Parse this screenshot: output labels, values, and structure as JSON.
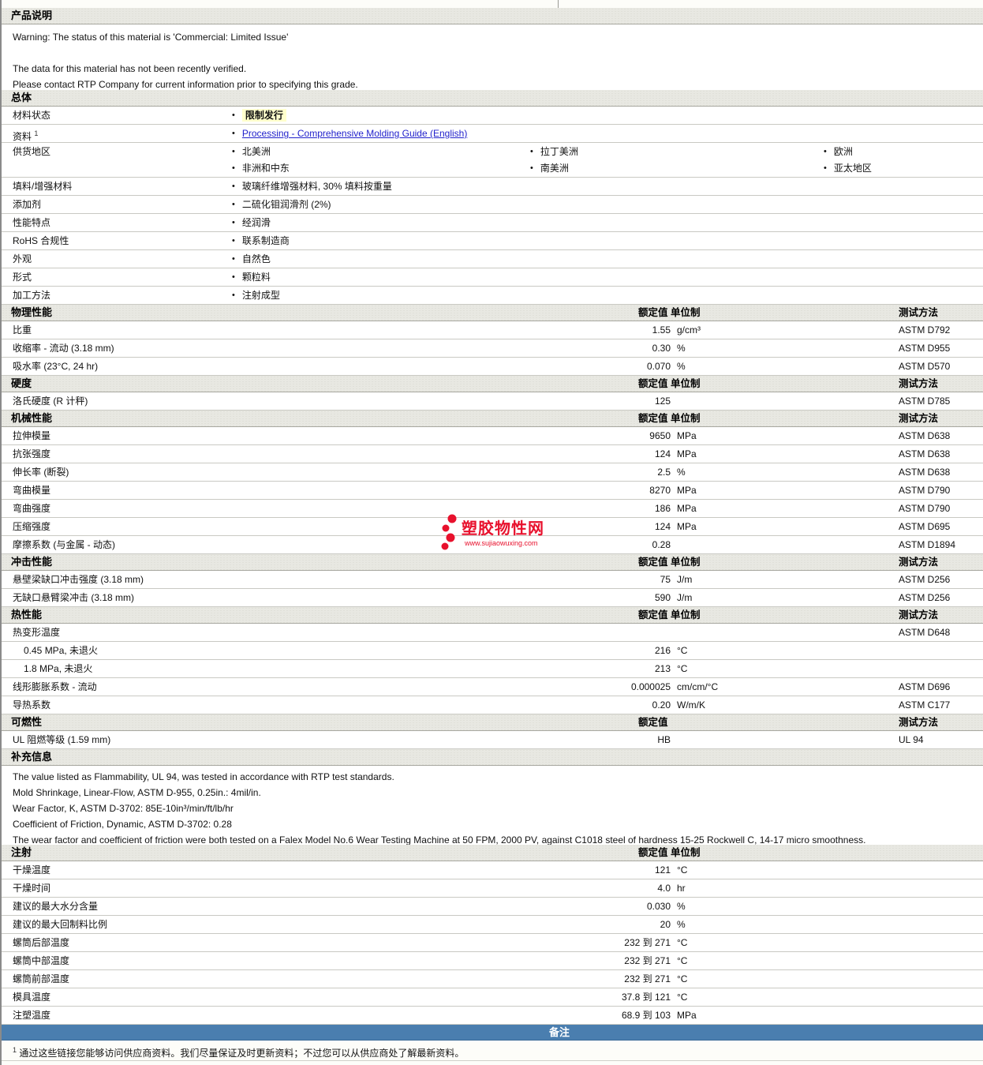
{
  "header": {
    "product_desc_title": "产品说明"
  },
  "description": {
    "line1": "Warning: The status of this material is 'Commercial: Limited Issue'",
    "line2": "The data for this material has not been recently verified.",
    "line3": "Please contact RTP Company for current information prior to specifying this grade."
  },
  "general": {
    "title": "总体",
    "rows": [
      {
        "label": "材料状态",
        "text": "限制发行"
      },
      {
        "label": "资料",
        "sup": "1",
        "text": "Processing - Comprehensive Molding Guide (English)"
      },
      {
        "label": "供货地区",
        "cols": [
          [
            "北美洲",
            "非洲和中东"
          ],
          [
            "拉丁美洲",
            "南美洲"
          ],
          [
            "欧洲",
            "亚太地区"
          ]
        ]
      },
      {
        "label": "填料/增强材料",
        "text": "玻璃纤维增强材料, 30% 填料按重量"
      },
      {
        "label": "添加剂",
        "text": "二硫化钼润滑剂 (2%)"
      },
      {
        "label": "性能特点",
        "text": "经润滑"
      },
      {
        "label": "RoHS 合规性",
        "text": "联系制造商"
      },
      {
        "label": "外观",
        "text": "自然色"
      },
      {
        "label": "形式",
        "text": "颗粒料"
      },
      {
        "label": "加工方法",
        "text": "注射成型"
      }
    ]
  },
  "col_headers": {
    "value_unit": "额定值 单位制",
    "value_only": "额定值",
    "method": "测试方法"
  },
  "physical": {
    "title": "物理性能",
    "rows": [
      {
        "label": "比重",
        "value": "1.55",
        "unit": "g/cm³",
        "method": "ASTM D792"
      },
      {
        "label": "收缩率 - 流动 (3.18 mm)",
        "value": "0.30",
        "unit": "%",
        "method": "ASTM D955"
      },
      {
        "label": "吸水率 (23°C, 24 hr)",
        "value": "0.070",
        "unit": "%",
        "method": "ASTM D570"
      }
    ]
  },
  "hardness": {
    "title": "硬度",
    "rows": [
      {
        "label": "洛氏硬度 (R 计秤)",
        "value": "125",
        "unit": "",
        "method": "ASTM D785"
      }
    ]
  },
  "mechanical": {
    "title": "机械性能",
    "rows": [
      {
        "label": "拉伸模量",
        "value": "9650",
        "unit": "MPa",
        "method": "ASTM D638"
      },
      {
        "label": "抗张强度",
        "value": "124",
        "unit": "MPa",
        "method": "ASTM D638"
      },
      {
        "label": "伸长率 (断裂)",
        "value": "2.5",
        "unit": "%",
        "method": "ASTM D638"
      },
      {
        "label": "弯曲模量",
        "value": "8270",
        "unit": "MPa",
        "method": "ASTM D790"
      },
      {
        "label": "弯曲强度",
        "value": "186",
        "unit": "MPa",
        "method": "ASTM D790"
      },
      {
        "label": "压缩强度",
        "value": "124",
        "unit": "MPa",
        "method": "ASTM D695"
      },
      {
        "label": "摩擦系数 (与金属 - 动态)",
        "value": "0.28",
        "unit": "",
        "method": "ASTM D1894"
      }
    ]
  },
  "impact": {
    "title": "冲击性能",
    "rows": [
      {
        "label": "悬壁梁缺口冲击强度 (3.18 mm)",
        "value": "75",
        "unit": "J/m",
        "method": "ASTM D256"
      },
      {
        "label": "无缺口悬臂梁冲击 (3.18 mm)",
        "value": "590",
        "unit": "J/m",
        "method": "ASTM D256"
      }
    ]
  },
  "thermal": {
    "title": "热性能",
    "rows": [
      {
        "label": "热变形温度",
        "value": "",
        "unit": "",
        "method": "ASTM D648"
      },
      {
        "label": "0.45 MPa, 未退火",
        "value": "216",
        "unit": "°C",
        "method": ""
      },
      {
        "label": "1.8 MPa, 未退火",
        "value": "213",
        "unit": "°C",
        "method": ""
      },
      {
        "label": "线形膨胀系数 - 流动",
        "value": "0.000025",
        "unit": "cm/cm/°C",
        "method": "ASTM D696"
      },
      {
        "label": "导热系数",
        "value": "0.20",
        "unit": "W/m/K",
        "method": "ASTM C177"
      }
    ]
  },
  "flammability": {
    "title": "可燃性",
    "rows": [
      {
        "label": "UL 阻燃等级 (1.59 mm)",
        "value": "HB",
        "unit": "",
        "method": "UL 94"
      }
    ]
  },
  "supplementary": {
    "title": "补充信息",
    "lines": [
      "The value listed as Flammability, UL 94, was tested in accordance with RTP test standards.",
      "Mold Shrinkage, Linear-Flow, ASTM D-955, 0.25in.: 4mil/in.",
      "Wear Factor, K, ASTM D-3702: 85E-10in³/min/ft/lb/hr",
      "Coefficient of Friction, Dynamic, ASTM D-3702: 0.28",
      "The wear factor and coefficient of friction were both tested on a Falex Model No.6 Wear Testing Machine at 50 FPM, 2000 PV, against C1018 steel of hardness 15-25 Rockwell C, 14-17 micro smoothness."
    ]
  },
  "injection": {
    "title": "注射",
    "rows": [
      {
        "label": "干燥温度",
        "value": "121",
        "unit": "°C"
      },
      {
        "label": "干燥时间",
        "value": "4.0",
        "unit": "hr"
      },
      {
        "label": "建议的最大水分含量",
        "value": "0.030",
        "unit": "%"
      },
      {
        "label": "建议的最大回制料比例",
        "value": "20",
        "unit": "%"
      },
      {
        "label": "螺筒后部温度",
        "value": "232 到 271",
        "unit": "°C"
      },
      {
        "label": "螺筒中部温度",
        "value": "232 到 271",
        "unit": "°C"
      },
      {
        "label": "螺筒前部温度",
        "value": "232 到 271",
        "unit": "°C"
      },
      {
        "label": "模具温度",
        "value": "37.8 到 121",
        "unit": "°C"
      },
      {
        "label": "注塑温度",
        "value": "68.9 到 103",
        "unit": "MPa"
      }
    ]
  },
  "remark": {
    "label": "备注"
  },
  "footnote": {
    "sup": "1",
    "text": "通过这些链接您能够访问供应商资料。我们尽量保证及时更新资料；不过您可以从供应商处了解最新资料。"
  },
  "watermark": {
    "name": "塑胶物性网",
    "url": "www.sujiaowuxing.com"
  },
  "colors": {
    "remark_bar": "#4A7EAF",
    "link": "#2222CC",
    "highlight": "#FFFFCC",
    "watermark_red": "#E8112D",
    "band_bg": "#E8E8E2"
  }
}
